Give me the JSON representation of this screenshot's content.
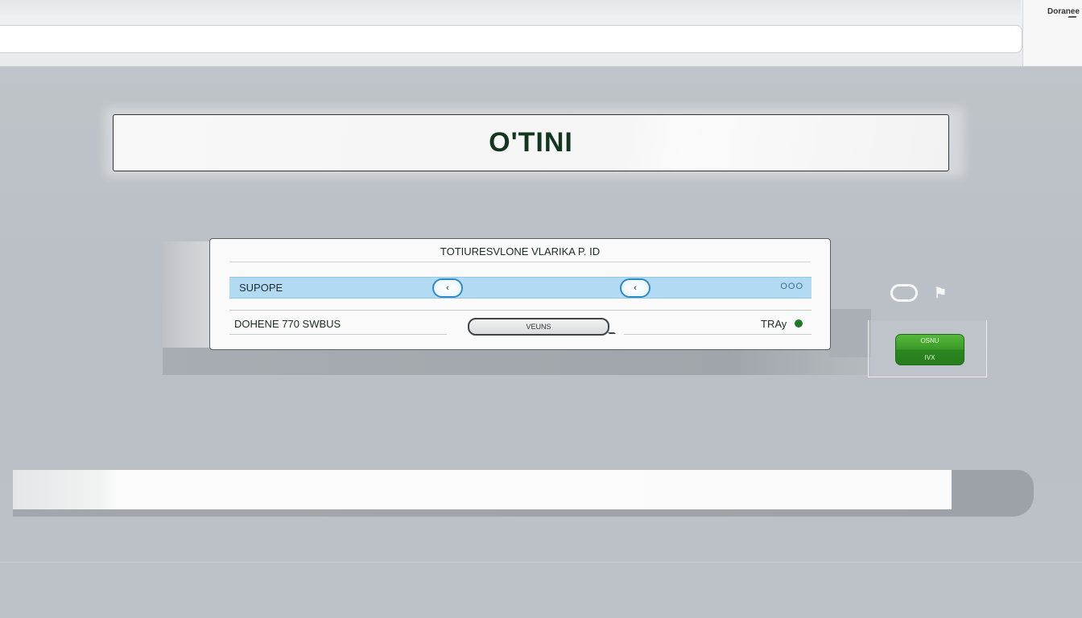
{
  "browser": {
    "address_value": "",
    "corner_label": "Doranee"
  },
  "banner": {
    "title": "O'TINI"
  },
  "dialog": {
    "title": "TOTIURESVLONE VLARIKA P. ID",
    "selected_row": {
      "label": "SUPOPE",
      "stepper_left": "‹",
      "stepper_right": "‹",
      "dots": "OOO"
    },
    "bottom_row": {
      "label": "DOHENE 770 SWBUS",
      "input_value": "VEUNS",
      "tray_label": "TRAy"
    }
  },
  "side_controls": {
    "flag_glyph": "⚑",
    "green_button": {
      "top_label": "OSNU",
      "bottom_label": "IVX",
      "color": "#3c9b29"
    }
  },
  "bottom_bar": {
    "value": ""
  }
}
